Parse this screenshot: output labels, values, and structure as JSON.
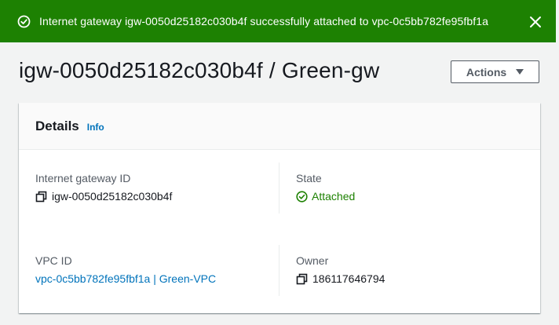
{
  "flash": {
    "message": "Internet gateway igw-0050d25182c030b4f successfully attached to vpc-0c5bb782fe95fbf1a",
    "type": "success",
    "icon": "check-circle-icon",
    "close_icon": "close-icon"
  },
  "header": {
    "title": "igw-0050d25182c030b4f / Green-gw",
    "actions_label": "Actions"
  },
  "details": {
    "title": "Details",
    "info_label": "Info",
    "fields": {
      "igw_id": {
        "label": "Internet gateway ID",
        "value": "igw-0050d25182c030b4f"
      },
      "state": {
        "label": "State",
        "value": "Attached"
      },
      "vpc_id": {
        "label": "VPC ID",
        "value": "vpc-0c5bb782fe95fbf1a | Green-VPC"
      },
      "owner": {
        "label": "Owner",
        "value": "186117646794"
      }
    }
  },
  "colors": {
    "success": "#1d8102",
    "link": "#0073bb",
    "label": "#545b64",
    "text": "#16191f"
  }
}
